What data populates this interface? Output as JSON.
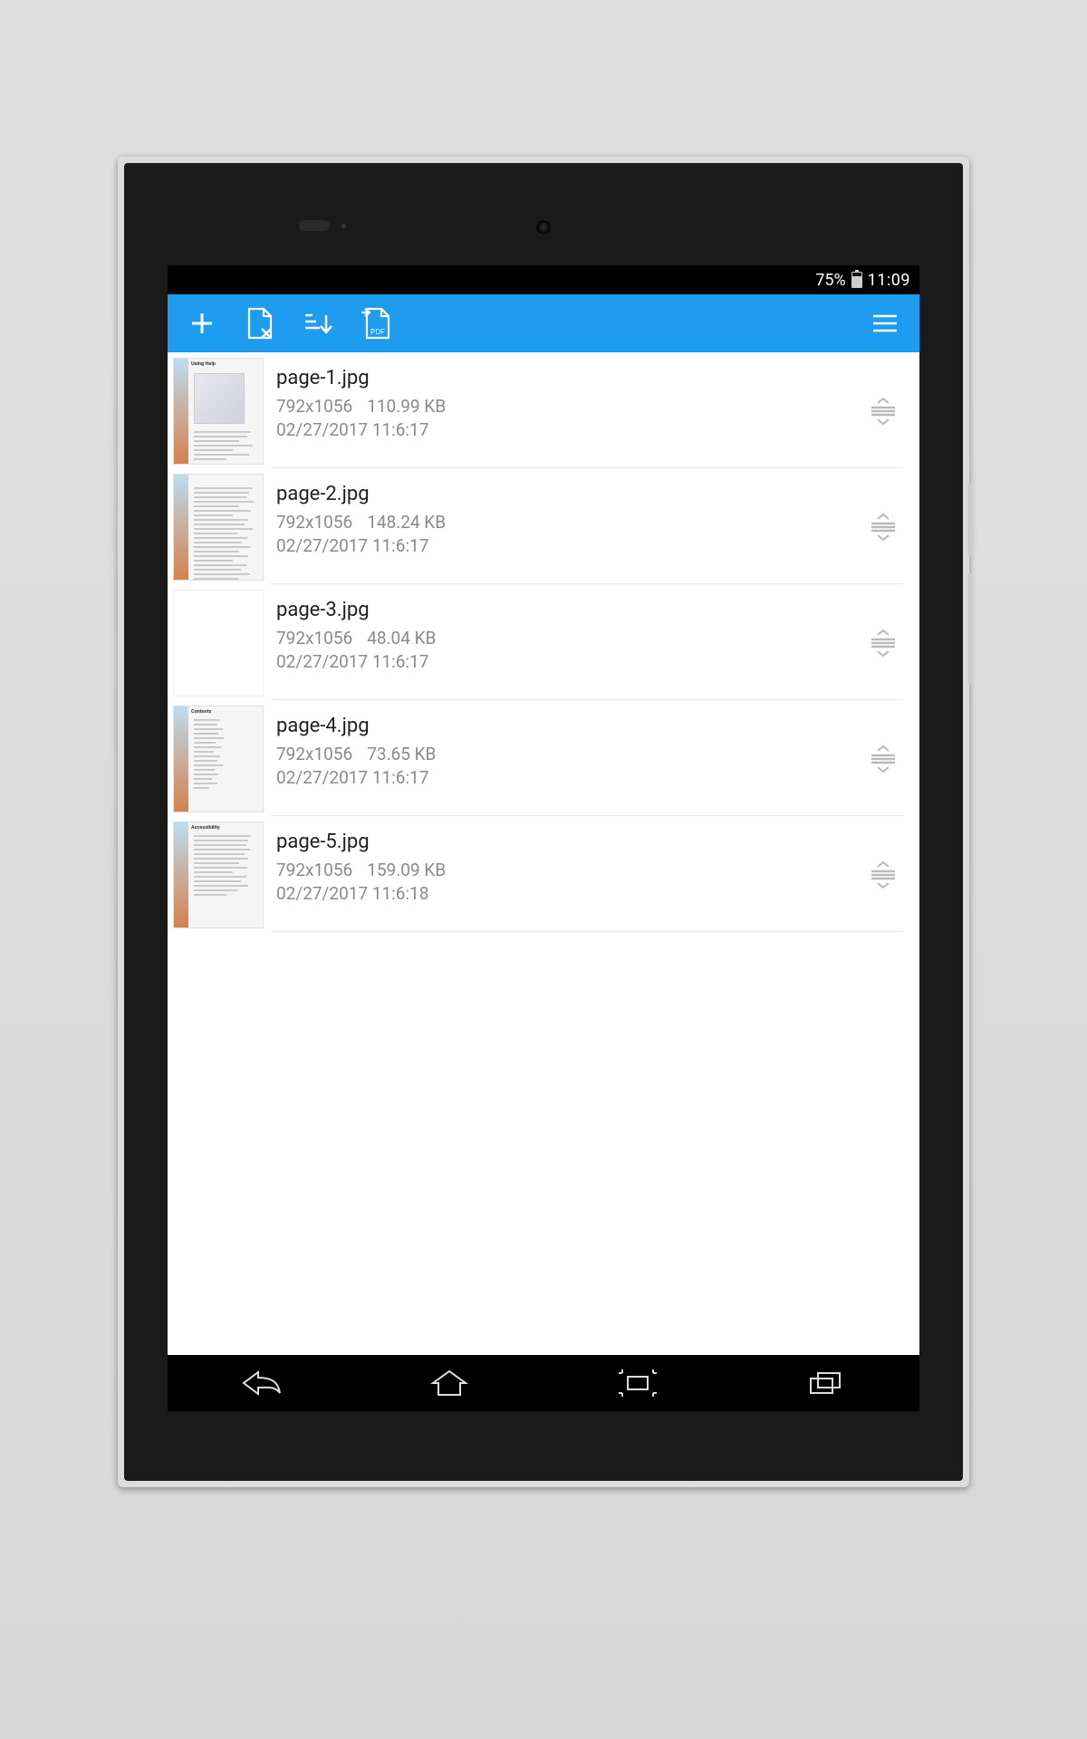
{
  "status": {
    "battery_pct": "75%",
    "time": "11:09"
  },
  "toolbar": {
    "add": "add",
    "delete_page": "delete-page",
    "sort": "sort",
    "export_pdf": "export-pdf",
    "menu": "menu"
  },
  "files": [
    {
      "name": "page-1.jpg",
      "dims": "792x1056",
      "size": "110.99 KB",
      "date": "02/27/2017 11:6:17",
      "thumb_title": "Using Help",
      "thumb_variant": "helpimg"
    },
    {
      "name": "page-2.jpg",
      "dims": "792x1056",
      "size": "148.24 KB",
      "date": "02/27/2017 11:6:17",
      "thumb_title": "",
      "thumb_variant": "dense"
    },
    {
      "name": "page-3.jpg",
      "dims": "792x1056",
      "size": "48.04 KB",
      "date": "02/27/2017 11:6:17",
      "thumb_title": "",
      "thumb_variant": "blank"
    },
    {
      "name": "page-4.jpg",
      "dims": "792x1056",
      "size": "73.65 KB",
      "date": "02/27/2017 11:6:17",
      "thumb_title": "Contents",
      "thumb_variant": "contents"
    },
    {
      "name": "page-5.jpg",
      "dims": "792x1056",
      "size": "159.09 KB",
      "date": "02/27/2017 11:6:18",
      "thumb_title": "Accessibility",
      "thumb_variant": "lines"
    }
  ]
}
